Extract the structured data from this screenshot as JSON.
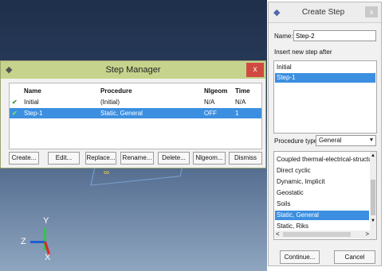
{
  "viewport": {
    "axes": {
      "y": "Y",
      "z": "Z",
      "x": "X"
    },
    "mark": "∞"
  },
  "step_manager": {
    "title": "Step Manager",
    "close_label": "x",
    "columns": {
      "name": "Name",
      "procedure": "Procedure",
      "nlgeom": "Nlgeom",
      "time": "Time"
    },
    "rows": [
      {
        "check": "✔",
        "name": "Initial",
        "procedure": "(Initial)",
        "nlgeom": "N/A",
        "time": "N/A",
        "selected": false
      },
      {
        "check": "✔",
        "name": "Step-1",
        "procedure": "Static, General",
        "nlgeom": "OFF",
        "time": "1",
        "selected": true
      }
    ],
    "buttons": {
      "create": "Create...",
      "edit": "Edit...",
      "replace": "Replace...",
      "rename": "Rename...",
      "delete": "Delete...",
      "nlgeom": "Nlgeom...",
      "dismiss": "Dismiss"
    }
  },
  "create_step": {
    "title": "Create Step",
    "close_label": "x",
    "name_label": "Name:",
    "name_value": "Step-2",
    "insert_label": "Insert new step after",
    "after_items": [
      "Initial",
      "Step-1"
    ],
    "after_selected": "Step-1",
    "procedure_type_label": "Procedure type:",
    "procedure_type_value": "General",
    "procedures": [
      "Coupled thermal-electrical-structural",
      "Direct cyclic",
      "Dynamic, Implicit",
      "Geostatic",
      "Soils",
      "Static, General",
      "Static, Riks"
    ],
    "procedure_selected": "Static, General",
    "continue_label": "Continue...",
    "cancel_label": "Cancel"
  },
  "colors": {
    "selection": "#3c8fe0",
    "step_manager_titlebar": "#c6d38c",
    "close_red": "#d04a42"
  }
}
